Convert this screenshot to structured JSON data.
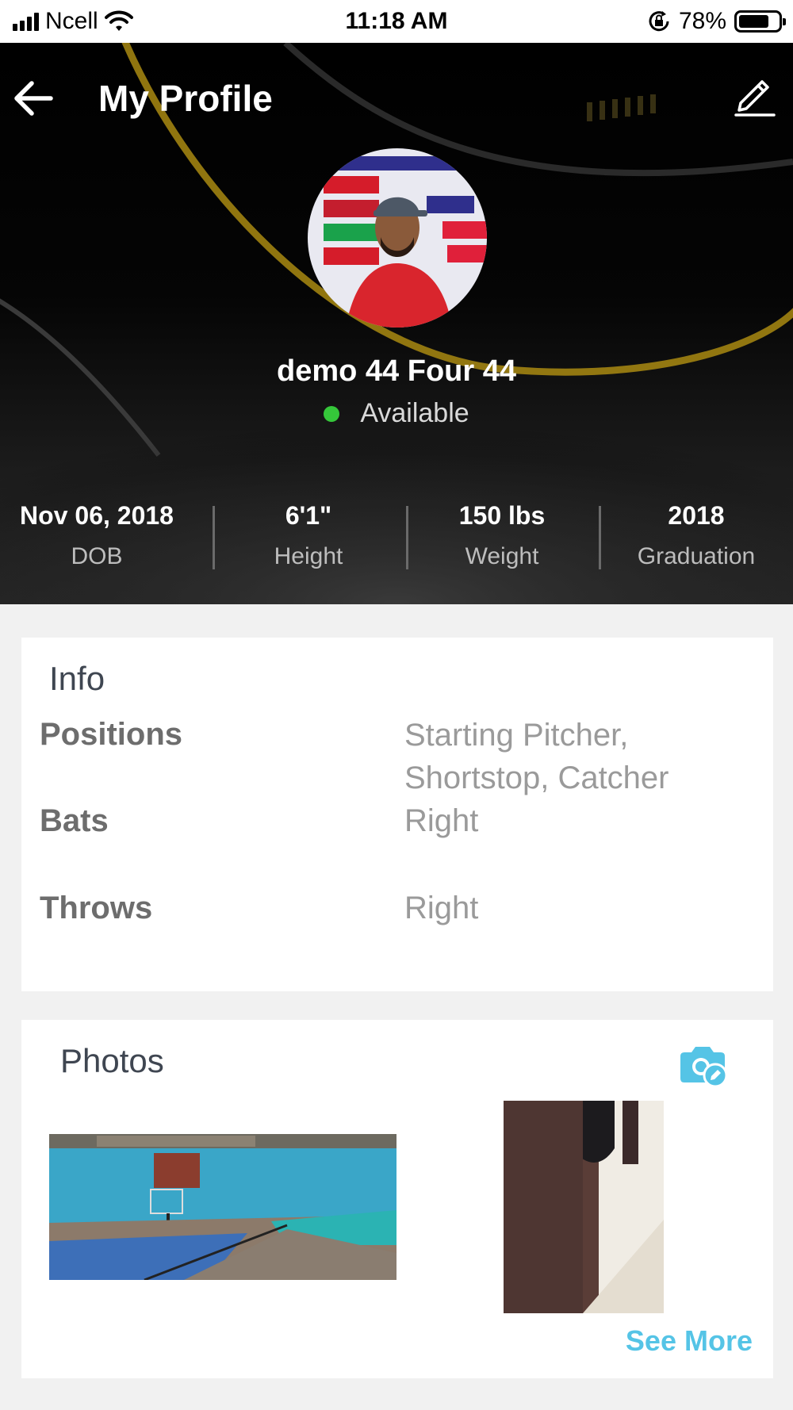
{
  "status_bar": {
    "carrier": "Ncell",
    "time": "11:18 AM",
    "battery_percent": "78%",
    "battery_level": 0.78
  },
  "header": {
    "title": "My Profile",
    "back_icon": "back-arrow-icon",
    "edit_icon": "pencil-icon"
  },
  "profile": {
    "name": "demo 44 Four 44",
    "status": "Available",
    "status_color": "#35c73a",
    "stats": [
      {
        "value": "Nov 06, 2018",
        "label": "DOB"
      },
      {
        "value": "6'1\"",
        "label": "Height"
      },
      {
        "value": "150 lbs",
        "label": "Weight"
      },
      {
        "value": "2018",
        "label": "Graduation"
      }
    ]
  },
  "info": {
    "title": "Info",
    "rows": [
      {
        "label": "Positions",
        "value": "Starting Pitcher, Shortstop, Catcher"
      },
      {
        "label": "Bats",
        "value": "Right"
      },
      {
        "label": "Throws",
        "value": "Right"
      }
    ]
  },
  "photos": {
    "title": "Photos",
    "camera_icon": "camera-edit-icon",
    "accent_color": "#55c4e6",
    "see_more": "See More"
  }
}
